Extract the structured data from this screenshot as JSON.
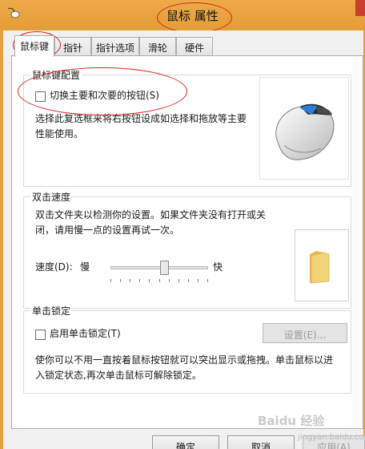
{
  "window": {
    "title": "鼠标 属性"
  },
  "tabs": [
    {
      "label": "鼠标键"
    },
    {
      "label": "指针"
    },
    {
      "label": "指针选项"
    },
    {
      "label": "滑轮"
    },
    {
      "label": "硬件"
    }
  ],
  "button_config": {
    "legend": "鼠标键配置",
    "swap_label": "切换主要和次要的按钮(S)",
    "swap_checked": false,
    "description_line1": "选择此复选框来将右按钮设成如选择和拖放等主要",
    "description_line2": "性能使用。"
  },
  "double_click": {
    "legend": "双击速度",
    "description_line1": "双击文件夹以检测你的设置。如果文件夹没有打开或关",
    "description_line2": "闭，请用慢一点的设置再试一次。",
    "speed_label": "速度(D):",
    "slow_label": "慢",
    "fast_label": "快",
    "speed_value_fraction": 0.55
  },
  "click_lock": {
    "legend": "单击锁定",
    "enable_label": "启用单击锁定(T)",
    "enable_checked": false,
    "settings_button": "设置(E)...",
    "description_line1": "使你可以不用一直按着鼠标按钮就可以突出显示或拖拽。单击鼠标以进",
    "description_line2": "入锁定状态,再次单击鼠标可解除锁定。"
  },
  "footer": {
    "ok": "确定",
    "cancel": "取消",
    "apply": "应用(A)"
  },
  "watermark": {
    "text": "Baidu 经验",
    "sub": "jingyan.baidu.com"
  },
  "colors": {
    "titlebar": "#e6a23d",
    "annotation": "#d62020",
    "folder": "#f3d37a"
  }
}
